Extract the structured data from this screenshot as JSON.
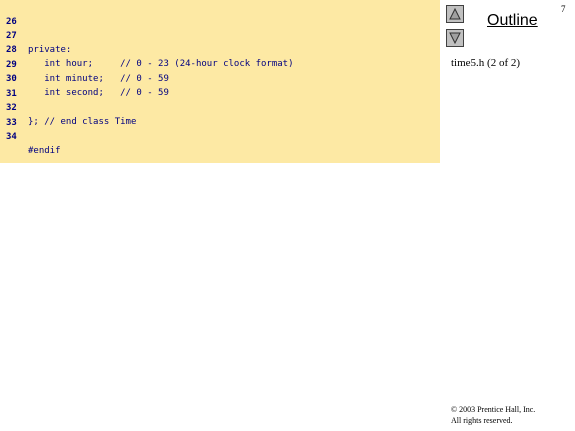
{
  "slide_number": "7",
  "outline": {
    "title": "Outline",
    "file_label": "time5.h (2 of 2)",
    "prev_icon": "triangle-up-icon",
    "next_icon": "triangle-down-icon"
  },
  "code": {
    "lines": [
      {
        "no": "26",
        "text": ""
      },
      {
        "no": "27",
        "text": "private:"
      },
      {
        "no": "28",
        "text": "   int hour;     // 0 - 23 (24-hour clock format)"
      },
      {
        "no": "29",
        "text": "   int minute;   // 0 - 59"
      },
      {
        "no": "30",
        "text": "   int second;   // 0 - 59"
      },
      {
        "no": "31",
        "text": ""
      },
      {
        "no": "32",
        "text": "}; // end class Time"
      },
      {
        "no": "33",
        "text": ""
      },
      {
        "no": "34",
        "text": "#endif"
      }
    ]
  },
  "copyright": {
    "line1": "© 2003 Prentice Hall, Inc.",
    "line2": "All rights reserved."
  },
  "colors": {
    "code_background": "#fde9a4",
    "code_text": "#000080"
  }
}
